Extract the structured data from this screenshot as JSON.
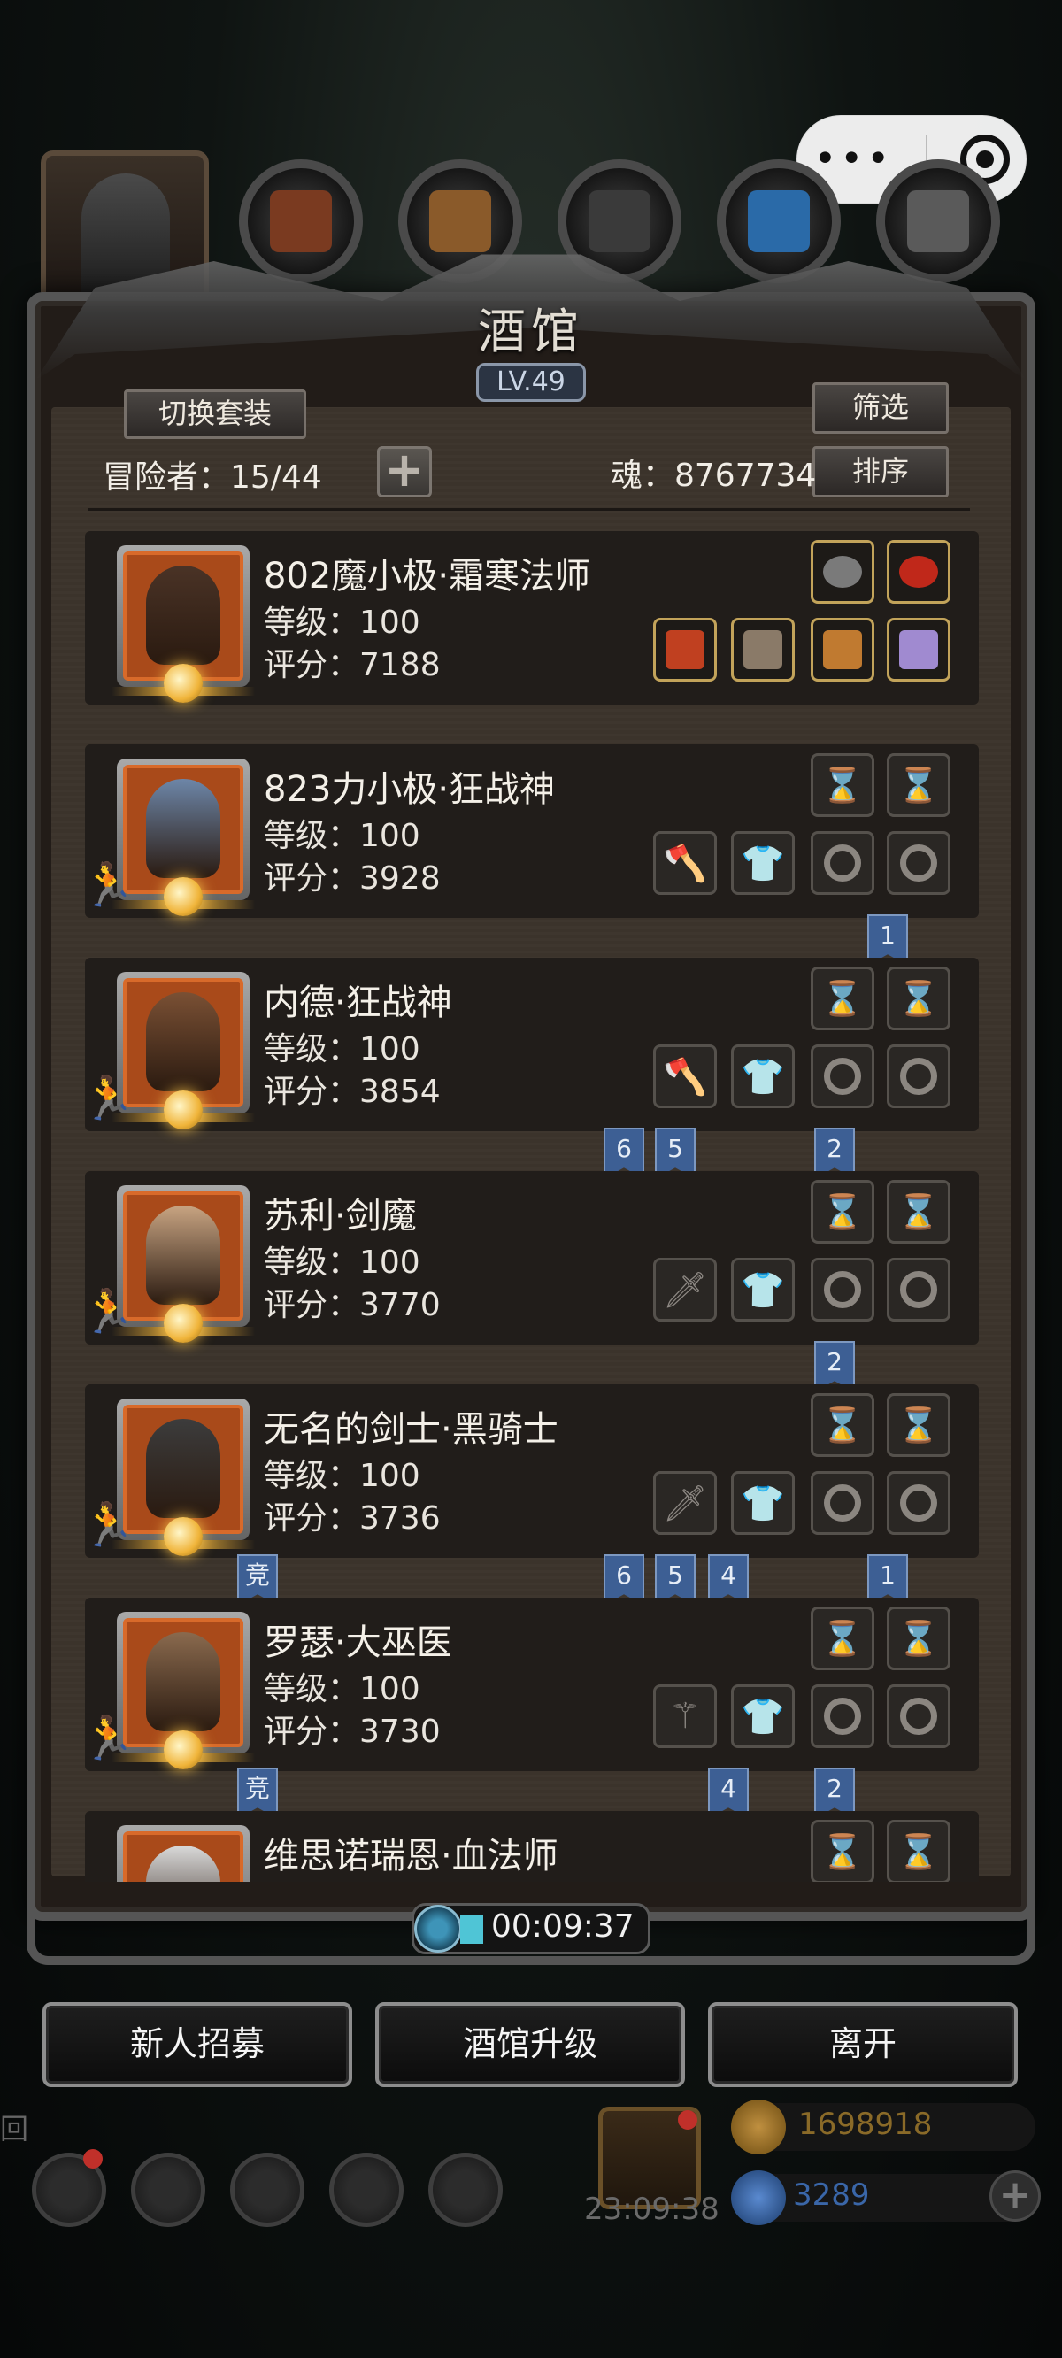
{
  "capsule": {
    "more": "•••",
    "close": "◉"
  },
  "panel": {
    "title": "酒馆",
    "level_badge": "LV.49",
    "switch_outfit_label": "切换套装",
    "filter_label": "筛选",
    "sort_label": "排序",
    "adventurer_count": "冒险者：15/44",
    "add_label": "+",
    "soul_count": "魂：8767734"
  },
  "heroes": [
    {
      "name": "802魔小极·霜寒法师",
      "level": "等级：100",
      "score": "评分：7188",
      "head_color": "#4a3326",
      "top_slots": [
        "feather",
        "gem"
      ],
      "bottom_slots": [
        "wand",
        "armor",
        "amulet",
        "tome"
      ],
      "equipped": true,
      "bookmarks": []
    },
    {
      "name": "823力小极·狂战神",
      "level": "等级：100",
      "score": "评分：3928",
      "head_color": "#6d86a8",
      "equipped": false,
      "bottom_tool": "axe",
      "bookmarks": [
        {
          "label": "1",
          "pos": "r4"
        }
      ]
    },
    {
      "name": "内德·狂战神",
      "level": "等级：100",
      "score": "评分：3854",
      "head_color": "#7a5034",
      "equipped": false,
      "bottom_tool": "axe",
      "bookmarks": [
        {
          "label": "6",
          "pos": "b1"
        },
        {
          "label": "5",
          "pos": "b1b"
        },
        {
          "label": "2",
          "pos": "r3"
        }
      ]
    },
    {
      "name": "苏利·剑魔",
      "level": "等级：100",
      "score": "评分：3770",
      "head_color": "#c8a482",
      "equipped": false,
      "bottom_tool": "sword",
      "bookmarks": [
        {
          "label": "2",
          "pos": "r3"
        }
      ]
    },
    {
      "name": "无名的剑士·黑骑士",
      "level": "等级：100",
      "score": "评分：3736",
      "head_color": "#3c3c3c",
      "equipped": false,
      "bottom_tool": "sword",
      "bookmarks": [
        {
          "label": "竞",
          "pos": "left"
        },
        {
          "label": "6",
          "pos": "b1"
        },
        {
          "label": "5",
          "pos": "b1b"
        },
        {
          "label": "4",
          "pos": "b2"
        },
        {
          "label": "1",
          "pos": "r4"
        }
      ]
    },
    {
      "name": "罗瑟·大巫医",
      "level": "等级：100",
      "score": "评分：3730",
      "head_color": "#8a6a4e",
      "equipped": false,
      "bottom_tool": "staff",
      "bookmarks": [
        {
          "label": "竞",
          "pos": "left"
        },
        {
          "label": "4",
          "pos": "b2"
        },
        {
          "label": "2",
          "pos": "r3"
        }
      ]
    },
    {
      "name": "维思诺瑞恩·血法师",
      "level": "",
      "score": "",
      "head_color": "#d9d9d9",
      "equipped": false,
      "bottom_tool": "staff",
      "bookmarks": []
    }
  ],
  "timer": "00:09:37",
  "actions": {
    "recruit": "新人招募",
    "upgrade": "酒馆升级",
    "leave": "离开"
  },
  "hud": {
    "gift_timer": "23:09:38",
    "gold": "1698918",
    "gems": "3289",
    "left_text": "回"
  }
}
